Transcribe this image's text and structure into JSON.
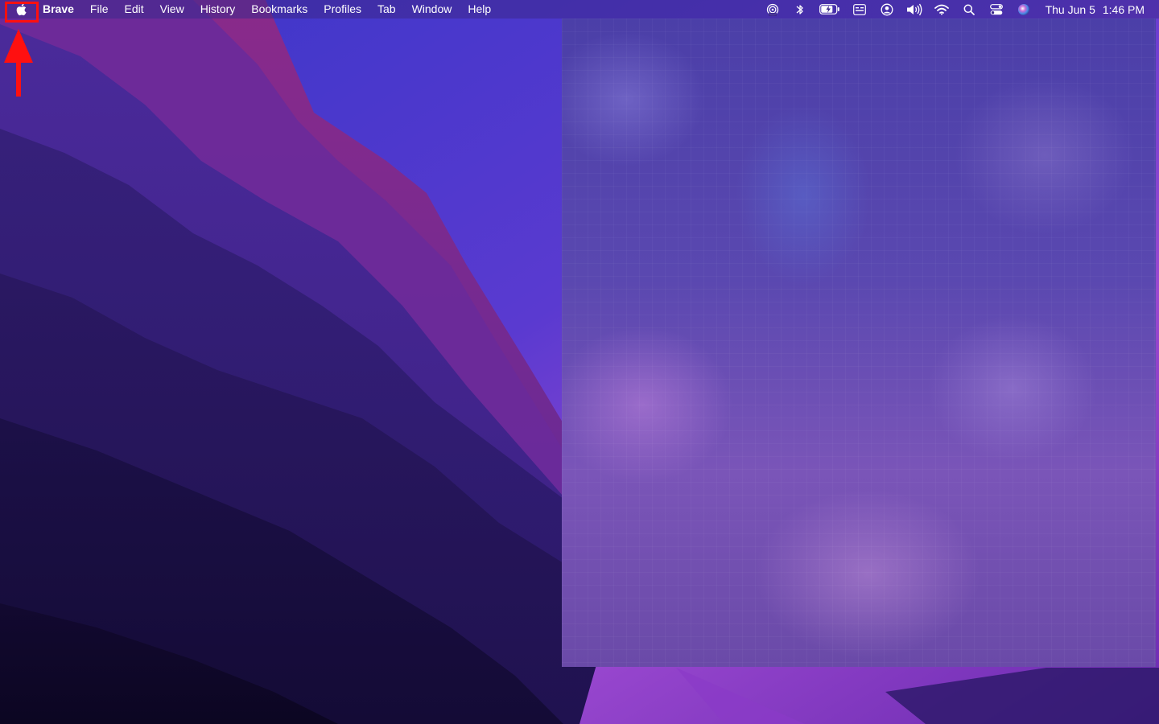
{
  "menubar": {
    "app_name": "Brave",
    "menus": [
      "File",
      "Edit",
      "View",
      "History",
      "Bookmarks",
      "Profiles",
      "Tab",
      "Window",
      "Help"
    ],
    "status_icons": [
      "airdrop-icon",
      "bluetooth-icon",
      "battery-icon",
      "keyboard-input-icon",
      "user-icon",
      "volume-icon",
      "wifi-icon",
      "search-icon",
      "control-center-icon",
      "siri-icon"
    ],
    "date": "Thu Jun 5",
    "time": "1:46 PM"
  },
  "annotation": {
    "highlight_color": "#ff1010",
    "target": "apple-menu-icon"
  },
  "colors": {
    "menubar_text": "#ffffff",
    "wallpaper_accent": "#7a3fc0"
  }
}
